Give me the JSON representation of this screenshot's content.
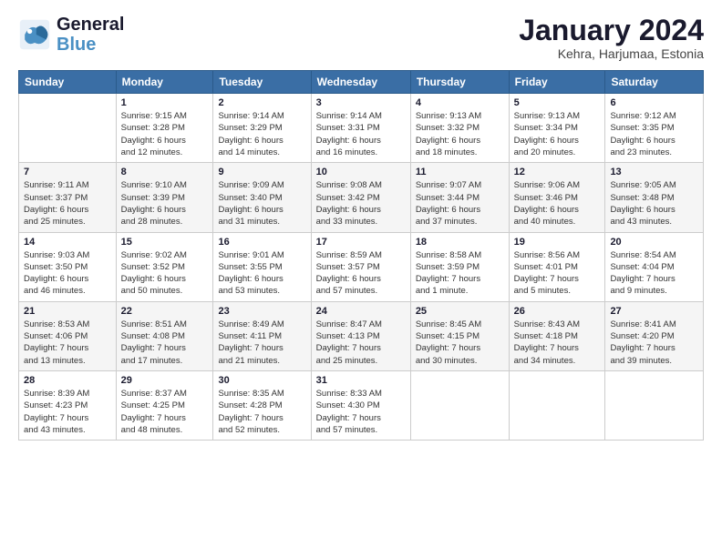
{
  "logo": {
    "line1": "General",
    "line2": "Blue"
  },
  "header": {
    "month_year": "January 2024",
    "location": "Kehra, Harjumaa, Estonia"
  },
  "weekdays": [
    "Sunday",
    "Monday",
    "Tuesday",
    "Wednesday",
    "Thursday",
    "Friday",
    "Saturday"
  ],
  "weeks": [
    [
      {
        "day": "",
        "info": ""
      },
      {
        "day": "1",
        "info": "Sunrise: 9:15 AM\nSunset: 3:28 PM\nDaylight: 6 hours\nand 12 minutes."
      },
      {
        "day": "2",
        "info": "Sunrise: 9:14 AM\nSunset: 3:29 PM\nDaylight: 6 hours\nand 14 minutes."
      },
      {
        "day": "3",
        "info": "Sunrise: 9:14 AM\nSunset: 3:31 PM\nDaylight: 6 hours\nand 16 minutes."
      },
      {
        "day": "4",
        "info": "Sunrise: 9:13 AM\nSunset: 3:32 PM\nDaylight: 6 hours\nand 18 minutes."
      },
      {
        "day": "5",
        "info": "Sunrise: 9:13 AM\nSunset: 3:34 PM\nDaylight: 6 hours\nand 20 minutes."
      },
      {
        "day": "6",
        "info": "Sunrise: 9:12 AM\nSunset: 3:35 PM\nDaylight: 6 hours\nand 23 minutes."
      }
    ],
    [
      {
        "day": "7",
        "info": "Sunrise: 9:11 AM\nSunset: 3:37 PM\nDaylight: 6 hours\nand 25 minutes."
      },
      {
        "day": "8",
        "info": "Sunrise: 9:10 AM\nSunset: 3:39 PM\nDaylight: 6 hours\nand 28 minutes."
      },
      {
        "day": "9",
        "info": "Sunrise: 9:09 AM\nSunset: 3:40 PM\nDaylight: 6 hours\nand 31 minutes."
      },
      {
        "day": "10",
        "info": "Sunrise: 9:08 AM\nSunset: 3:42 PM\nDaylight: 6 hours\nand 33 minutes."
      },
      {
        "day": "11",
        "info": "Sunrise: 9:07 AM\nSunset: 3:44 PM\nDaylight: 6 hours\nand 37 minutes."
      },
      {
        "day": "12",
        "info": "Sunrise: 9:06 AM\nSunset: 3:46 PM\nDaylight: 6 hours\nand 40 minutes."
      },
      {
        "day": "13",
        "info": "Sunrise: 9:05 AM\nSunset: 3:48 PM\nDaylight: 6 hours\nand 43 minutes."
      }
    ],
    [
      {
        "day": "14",
        "info": "Sunrise: 9:03 AM\nSunset: 3:50 PM\nDaylight: 6 hours\nand 46 minutes."
      },
      {
        "day": "15",
        "info": "Sunrise: 9:02 AM\nSunset: 3:52 PM\nDaylight: 6 hours\nand 50 minutes."
      },
      {
        "day": "16",
        "info": "Sunrise: 9:01 AM\nSunset: 3:55 PM\nDaylight: 6 hours\nand 53 minutes."
      },
      {
        "day": "17",
        "info": "Sunrise: 8:59 AM\nSunset: 3:57 PM\nDaylight: 6 hours\nand 57 minutes."
      },
      {
        "day": "18",
        "info": "Sunrise: 8:58 AM\nSunset: 3:59 PM\nDaylight: 7 hours\nand 1 minute."
      },
      {
        "day": "19",
        "info": "Sunrise: 8:56 AM\nSunset: 4:01 PM\nDaylight: 7 hours\nand 5 minutes."
      },
      {
        "day": "20",
        "info": "Sunrise: 8:54 AM\nSunset: 4:04 PM\nDaylight: 7 hours\nand 9 minutes."
      }
    ],
    [
      {
        "day": "21",
        "info": "Sunrise: 8:53 AM\nSunset: 4:06 PM\nDaylight: 7 hours\nand 13 minutes."
      },
      {
        "day": "22",
        "info": "Sunrise: 8:51 AM\nSunset: 4:08 PM\nDaylight: 7 hours\nand 17 minutes."
      },
      {
        "day": "23",
        "info": "Sunrise: 8:49 AM\nSunset: 4:11 PM\nDaylight: 7 hours\nand 21 minutes."
      },
      {
        "day": "24",
        "info": "Sunrise: 8:47 AM\nSunset: 4:13 PM\nDaylight: 7 hours\nand 25 minutes."
      },
      {
        "day": "25",
        "info": "Sunrise: 8:45 AM\nSunset: 4:15 PM\nDaylight: 7 hours\nand 30 minutes."
      },
      {
        "day": "26",
        "info": "Sunrise: 8:43 AM\nSunset: 4:18 PM\nDaylight: 7 hours\nand 34 minutes."
      },
      {
        "day": "27",
        "info": "Sunrise: 8:41 AM\nSunset: 4:20 PM\nDaylight: 7 hours\nand 39 minutes."
      }
    ],
    [
      {
        "day": "28",
        "info": "Sunrise: 8:39 AM\nSunset: 4:23 PM\nDaylight: 7 hours\nand 43 minutes."
      },
      {
        "day": "29",
        "info": "Sunrise: 8:37 AM\nSunset: 4:25 PM\nDaylight: 7 hours\nand 48 minutes."
      },
      {
        "day": "30",
        "info": "Sunrise: 8:35 AM\nSunset: 4:28 PM\nDaylight: 7 hours\nand 52 minutes."
      },
      {
        "day": "31",
        "info": "Sunrise: 8:33 AM\nSunset: 4:30 PM\nDaylight: 7 hours\nand 57 minutes."
      },
      {
        "day": "",
        "info": ""
      },
      {
        "day": "",
        "info": ""
      },
      {
        "day": "",
        "info": ""
      }
    ]
  ]
}
